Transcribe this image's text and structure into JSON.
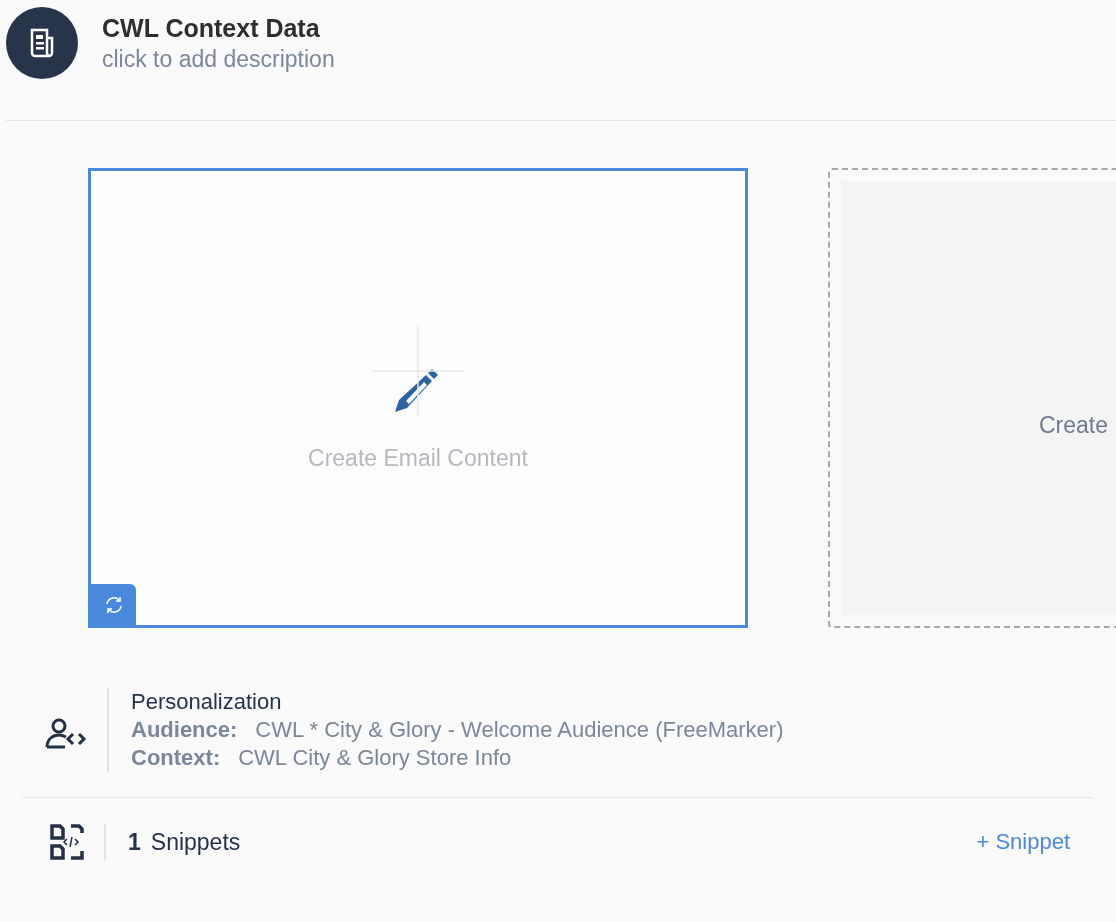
{
  "header": {
    "title": "CWL Context Data",
    "description": "click to add description"
  },
  "cards": [
    {
      "label": "Create Email Content",
      "selected": true
    },
    {
      "label": "Create",
      "selected": false
    }
  ],
  "personalization": {
    "title": "Personalization",
    "lines": [
      {
        "label": "Audience:",
        "value": "CWL * City & Glory - Welcome Audience (FreeMarker)"
      },
      {
        "label": "Context:",
        "value": "CWL City & Glory Store Info"
      }
    ]
  },
  "snippets": {
    "count": "1",
    "label": "Snippets",
    "action": "+ Snippet"
  }
}
